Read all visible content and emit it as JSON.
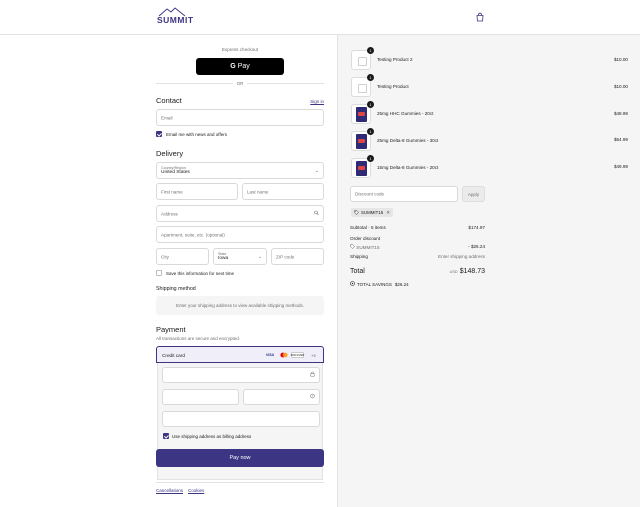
{
  "header": {
    "logo_text": "SUMMIT",
    "brand_color": "#3b3584",
    "cart_icon": "shopping-bag-icon"
  },
  "express": {
    "label": "Express checkout",
    "gpay_label": "Pay",
    "or_label": "OR"
  },
  "contact": {
    "title": "Contact",
    "signin_label": "Sign in",
    "email_placeholder": "Email",
    "email_value": "",
    "news_label": "Email me with news and offers",
    "news_checked": true
  },
  "delivery": {
    "title": "Delivery",
    "country_label": "Country/Region",
    "country_value": "United States",
    "first_name_placeholder": "First name",
    "last_name_placeholder": "Last name",
    "address_placeholder": "Address",
    "apartment_placeholder": "Apartment, suite, etc. (optional)",
    "city_placeholder": "City",
    "state_label": "State",
    "state_value": "Iowa",
    "zip_placeholder": "ZIP code",
    "save_label": "Save this information for next time",
    "save_checked": false
  },
  "shipping": {
    "title": "Shipping method",
    "message": "Enter your shipping address to view available shipping methods."
  },
  "payment": {
    "title": "Payment",
    "subtitle": "All transactions are secure and encrypted.",
    "method_label": "Credit card",
    "brands": [
      "VISA",
      "MC",
      "DISCOVER"
    ],
    "more_brands": "+3",
    "billing_label": "Use shipping address as billing address",
    "billing_checked": true,
    "pay_label": "Pay now"
  },
  "footer": {
    "links": [
      "Cancellations",
      "Cookies"
    ]
  },
  "summary": {
    "items": [
      {
        "name": "Testing Product 2",
        "qty": "1",
        "price": "$10.00",
        "image": "placeholder"
      },
      {
        "name": "Testing Product",
        "qty": "1",
        "price": "$10.00",
        "image": "placeholder"
      },
      {
        "name": "25mg HHC Gummies - 20ct",
        "qty": "1",
        "price": "$48.99",
        "image": "product"
      },
      {
        "name": "25mg Delta-8 Gummies - 30ct",
        "qty": "1",
        "price": "$54.99",
        "image": "product"
      },
      {
        "name": "15mg Delta-8 Gummies - 20ct",
        "qty": "1",
        "price": "$49.99",
        "image": "product"
      }
    ],
    "discount_placeholder": "Discount code",
    "apply_label": "Apply",
    "applied_code": "SUMMIT15",
    "subtotal_label": "Subtotal · 5 items",
    "subtotal_value": "$174.97",
    "order_discount_label": "Order discount",
    "discount_code": "SUMMIT15",
    "discount_value": "- $26.24",
    "shipping_label": "Shipping",
    "shipping_value": "Enter shipping address",
    "total_label": "Total",
    "currency": "USD",
    "total_value": "$148.73",
    "savings_label": "TOTAL SAVINGS",
    "savings_value": "$26.24"
  }
}
